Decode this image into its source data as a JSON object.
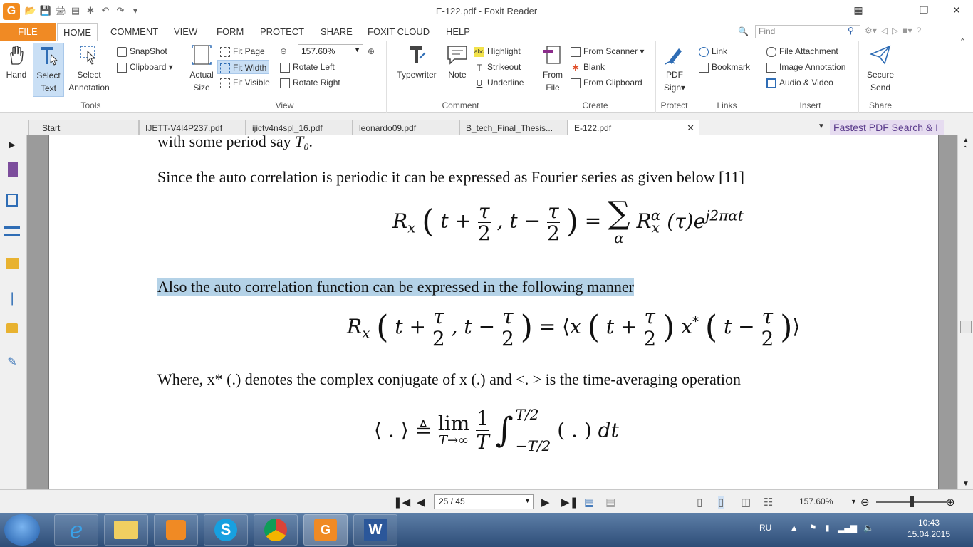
{
  "window": {
    "title": "E-122.pdf - Foxit Reader"
  },
  "menu": {
    "tabs": [
      "FILE",
      "HOME",
      "COMMENT",
      "VIEW",
      "FORM",
      "PROTECT",
      "SHARE",
      "FOXIT CLOUD",
      "HELP"
    ],
    "find_placeholder": "Find"
  },
  "ribbon": {
    "tools": {
      "hand": "Hand",
      "select_text_1": "Select",
      "select_text_2": "Text",
      "select_annotation_1": "Select",
      "select_annotation_2": "Annotation",
      "snapshot": "SnapShot",
      "clipboard": "Clipboard",
      "label": "Tools"
    },
    "view": {
      "actual_size_1": "Actual",
      "actual_size_2": "Size",
      "fit_page": "Fit Page",
      "fit_width": "Fit Width",
      "fit_visible": "Fit Visible",
      "zoom": "157.60%",
      "rotate_left": "Rotate Left",
      "rotate_right": "Rotate Right",
      "label": "View"
    },
    "comment": {
      "typewriter": "Typewriter",
      "note": "Note",
      "highlight": "Highlight",
      "strikeout": "Strikeout",
      "underline": "Underline",
      "label": "Comment"
    },
    "create": {
      "from_file_1": "From",
      "from_file_2": "File",
      "from_scanner": "From Scanner",
      "blank": "Blank",
      "from_clipboard": "From Clipboard",
      "label": "Create"
    },
    "protect": {
      "pdf_sign_1": "PDF",
      "pdf_sign_2": "Sign",
      "label": "Protect"
    },
    "links": {
      "link": "Link",
      "bookmark": "Bookmark",
      "label": "Links"
    },
    "insert": {
      "file_attachment": "File Attachment",
      "image_annotation": "Image Annotation",
      "audio_video": "Audio & Video",
      "label": "Insert"
    },
    "share": {
      "secure_send_1": "Secure",
      "secure_send_2": "Send",
      "label": "Share"
    }
  },
  "doc_tabs": [
    "Start",
    "IJETT-V4I4P237.pdf",
    "ijictv4n4spl_16.pdf",
    "leonardo09.pdf",
    "B_tech_Final_Thesis...",
    "E-122.pdf"
  ],
  "ad_banner": "Fastest PDF Search & I",
  "document": {
    "line0": "with some period say ",
    "line0_math": "T₀.",
    "line1": "Since the auto correlation is periodic it can be expressed as Fourier series as given below [11]",
    "line2": "Also the auto correlation function can be expressed in the following manner",
    "line3": "Where, x* (.) denotes the complex conjugate of x (.) and <. > is the time-averaging operation"
  },
  "status": {
    "page": "25 / 45",
    "zoom": "157.60%"
  },
  "taskbar": {
    "lang": "RU",
    "time": "10:43",
    "date": "15.04.2015"
  }
}
